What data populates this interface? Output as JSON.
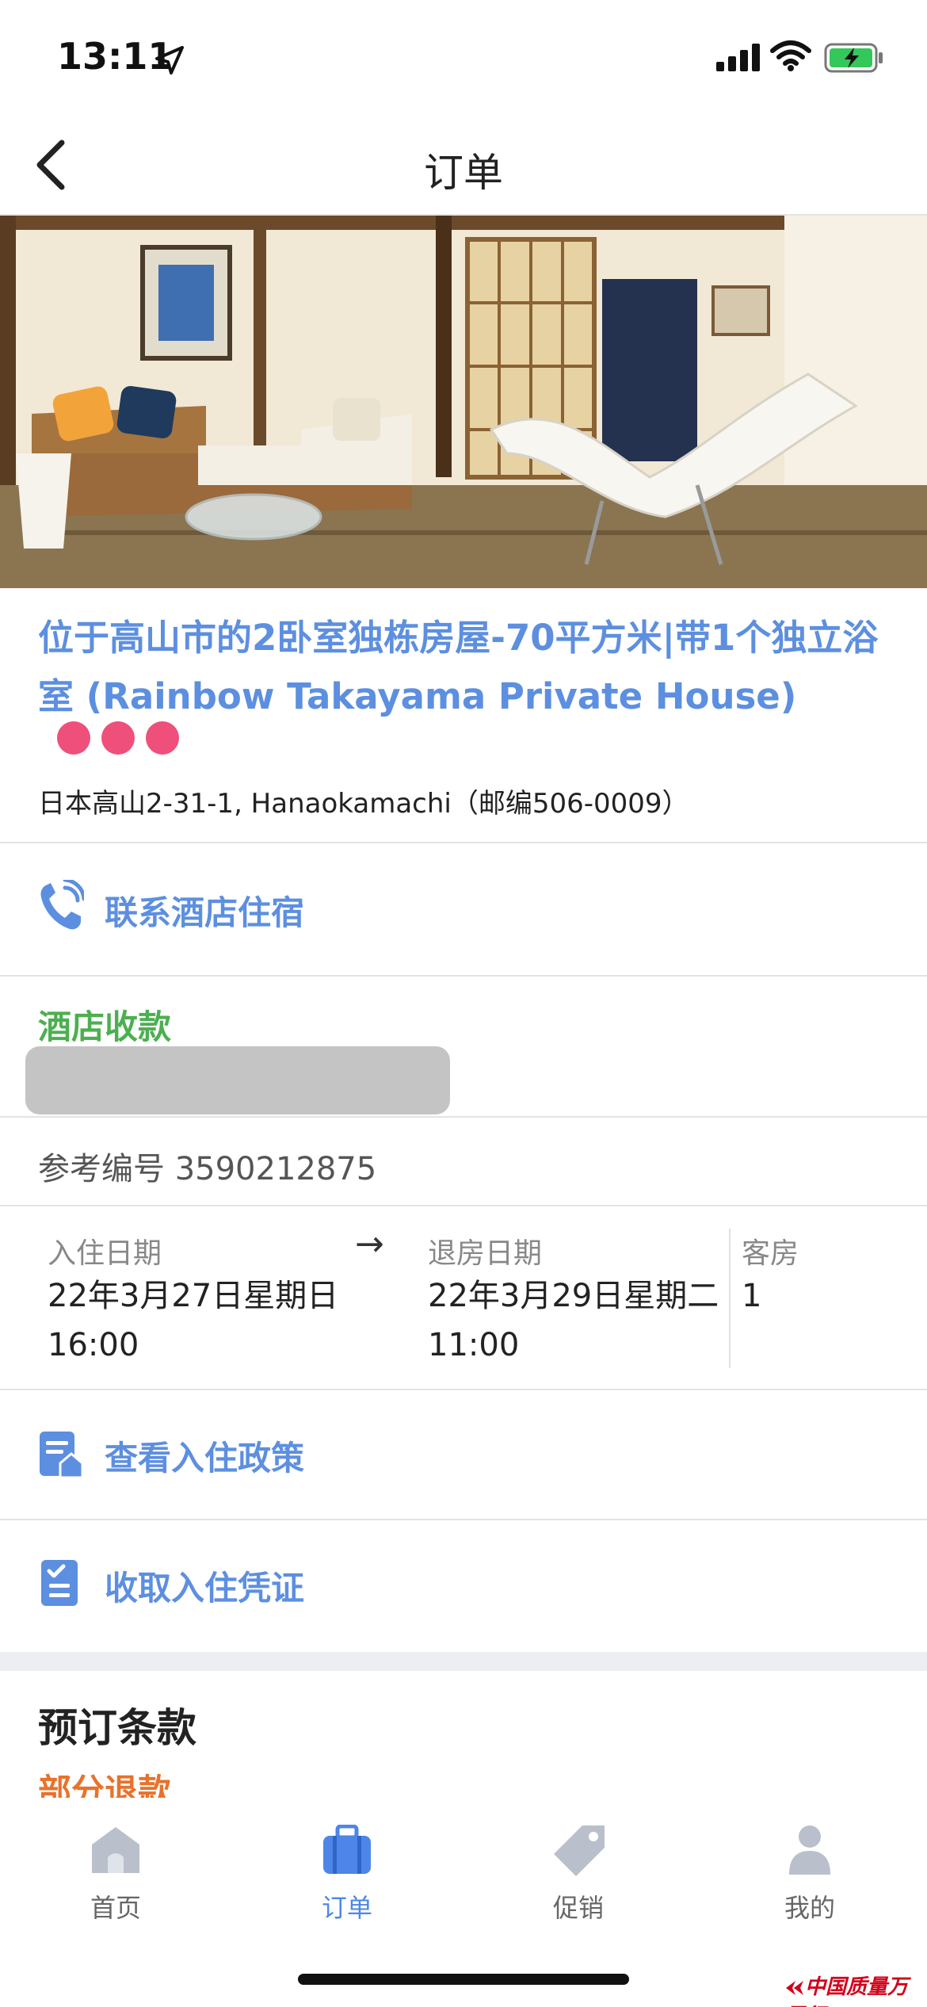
{
  "status": {
    "time": "13:11"
  },
  "nav": {
    "title": "订单"
  },
  "hotel": {
    "name": "位于高山市的2卧室独栋房屋-70平方米|带1个独立浴室 (Rainbow Takayama Private House)",
    "rating_dots": 3,
    "address": "日本高山2-31-1, Hanaokamachi（邮编506-0009）"
  },
  "contact": {
    "label": "联系酒店住宿"
  },
  "payment": {
    "label": "酒店收款"
  },
  "reference": {
    "text": "参考编号 3590212875"
  },
  "stay": {
    "checkin_label": "入住日期",
    "checkin_date": "22年3月27日星期日",
    "checkin_time": "16:00",
    "checkout_label": "退房日期",
    "checkout_date": "22年3月29日星期二",
    "checkout_time": "11:00",
    "rooms_label": "客房",
    "rooms_value": "1"
  },
  "policy": {
    "label": "查看入住政策"
  },
  "voucher": {
    "label": "收取入住凭证"
  },
  "terms": {
    "title": "预订条款",
    "subtitle": "部分退款"
  },
  "tabs": [
    {
      "label": "首页",
      "icon": "home-icon",
      "active": false
    },
    {
      "label": "订单",
      "icon": "briefcase-icon",
      "active": true
    },
    {
      "label": "促销",
      "icon": "tag-icon",
      "active": false
    },
    {
      "label": "我的",
      "icon": "user-icon",
      "active": false
    }
  ],
  "watermark": "中国质量万里行",
  "colors": {
    "accent": "#5d8fe0",
    "payment_green": "#4caf50",
    "terms_orange": "#e8722c",
    "rating_pink": "#ef4f7b",
    "tab_active": "#4d86e8",
    "tab_inactive": "#b9c0cc"
  }
}
